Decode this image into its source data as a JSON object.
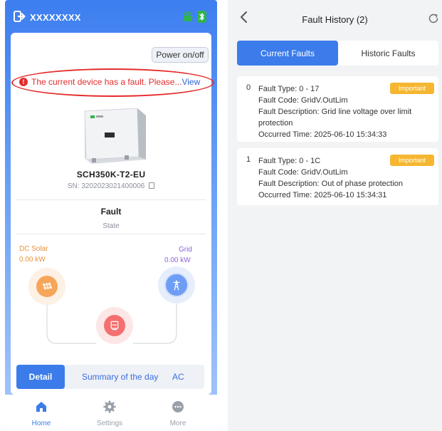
{
  "left_app": {
    "header": {
      "title": "XXXXXXXX"
    },
    "power_button": "Power on/off",
    "fault_banner": {
      "message": "The current device has a fault. Please...",
      "link": "View"
    },
    "device": {
      "model": "SCH350K-T2-EU",
      "sn": "SN: 3202023021400006"
    },
    "state": {
      "value": "Fault",
      "label": "State"
    },
    "energy_flow": {
      "dc_solar": {
        "name": "DC Solar",
        "value": "0.00 kW"
      },
      "grid": {
        "name": "Grid",
        "value": "0.00 kW"
      }
    },
    "detail_tabs": {
      "detail": "Detail",
      "summary": "Summary of the day",
      "ac": "AC"
    },
    "bottom_nav": {
      "home": "Home",
      "settings": "Settings",
      "more": "More"
    }
  },
  "right_app": {
    "header": {
      "title": "Fault History (2)"
    },
    "tabs": {
      "current": "Current Faults",
      "historic": "Historic Faults"
    },
    "faults": [
      {
        "index": "0",
        "type": "Fault Type: 0 - 17",
        "code": "Fault Code: GridV.OutLim",
        "description": "Fault Description: Grid line voltage over limit protection",
        "time": "Occurred Time: 2025-06-10 15:34:33",
        "badge": "Important"
      },
      {
        "index": "1",
        "type": "Fault Type: 0 - 1C",
        "code": "Fault Code: GridV.OutLim",
        "description": "Fault Description: Out of phase protection",
        "time": "Occurred Time: 2025-06-10 15:34:31",
        "badge": "Important"
      }
    ]
  },
  "colors": {
    "primary": "#3c7cea",
    "fault_red": "#e12d2d",
    "badge_orange": "#f5b731",
    "solar_orange": "#e9923d",
    "grid_purple": "#8a62d8"
  }
}
